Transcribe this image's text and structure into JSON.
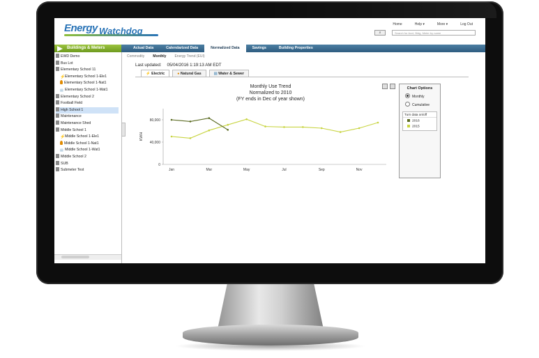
{
  "app": {
    "logo_text_1": "Energy",
    "logo_text_2": "Watchdog"
  },
  "topnav": [
    "Home",
    "Help ▾",
    "More ▾",
    "Log Out"
  ],
  "search": {
    "placeholder": "Search for Acct, Bldg, Meter by name"
  },
  "sidebar": {
    "header": "Buildings & Meters",
    "items": [
      {
        "label": "EWD Demo",
        "icon": "building-icon"
      },
      {
        "label": "Bus Lot",
        "icon": "building-icon"
      },
      {
        "label": "Elementary School 11",
        "icon": "building-icon"
      },
      {
        "label": "Elementary School 1-Ele1",
        "icon": "electric-icon"
      },
      {
        "label": "Elementary School 1-Nat1",
        "icon": "gas-icon"
      },
      {
        "label": "Elementary School 1-Wat1",
        "icon": "water-icon"
      },
      {
        "label": "Elementary School 2",
        "icon": "building-icon"
      },
      {
        "label": "Football Field",
        "icon": "building-icon"
      },
      {
        "label": "High School 1",
        "icon": "building-icon"
      },
      {
        "label": "Maintenance",
        "icon": "building-icon"
      },
      {
        "label": "Maintenance Shed",
        "icon": "building-icon"
      },
      {
        "label": "Middle School 1",
        "icon": "building-icon"
      },
      {
        "label": "Middle School 1-Ele1",
        "icon": "electric-icon"
      },
      {
        "label": "Middle School 1-Nat1",
        "icon": "gas-icon"
      },
      {
        "label": "Middle School 1-Wat1",
        "icon": "water-icon"
      },
      {
        "label": "Middle School 2",
        "icon": "building-icon"
      },
      {
        "label": "SUB",
        "icon": "building-icon"
      },
      {
        "label": "Submeter Test",
        "icon": "building-icon"
      }
    ]
  },
  "tabs": [
    "Actual Data",
    "Calendarized Data",
    "Normalized Data",
    "Savings",
    "Building Properties"
  ],
  "subtabs": [
    "Commodity",
    "Monthly",
    "Energy Trend (EUI)"
  ],
  "last_updated": {
    "label": "Last updated:",
    "value": "05/04/2016 1:19:13 AM EDT"
  },
  "energy_tabs": [
    "Electric",
    "Natural Gas",
    "Water & Sewer"
  ],
  "chart_options": {
    "title": "Chart Options",
    "options": [
      "Monthly",
      "Cumulative"
    ],
    "turn_header": "Turn data on/off"
  },
  "chart_data": {
    "type": "line",
    "title": "Monthly Use Trend",
    "subtitle": "Normalized to 2010",
    "note": "(FY ends in Dec of year shown)",
    "xlabel": "",
    "ylabel": "KWH",
    "x": [
      "Jan",
      "Feb",
      "Mar",
      "Apr",
      "May",
      "Jun",
      "Jul",
      "Aug",
      "Sep",
      "Oct",
      "Nov",
      "Dec"
    ],
    "x_tick_labels": [
      "Jan",
      "Mar",
      "May",
      "Jul",
      "Sep",
      "Nov"
    ],
    "y_ticks": [
      "0",
      "40,000",
      "80,000"
    ],
    "ylim": [
      0,
      100000
    ],
    "series": [
      {
        "name": "2016",
        "color": "#5b6b22",
        "values": [
          80000,
          77000,
          83000,
          62000
        ]
      },
      {
        "name": "2015",
        "color": "#c8d440",
        "values": [
          50000,
          47000,
          61000,
          71000,
          81000,
          68000,
          67000,
          67000,
          65000,
          58000,
          65000,
          75000
        ]
      }
    ]
  }
}
